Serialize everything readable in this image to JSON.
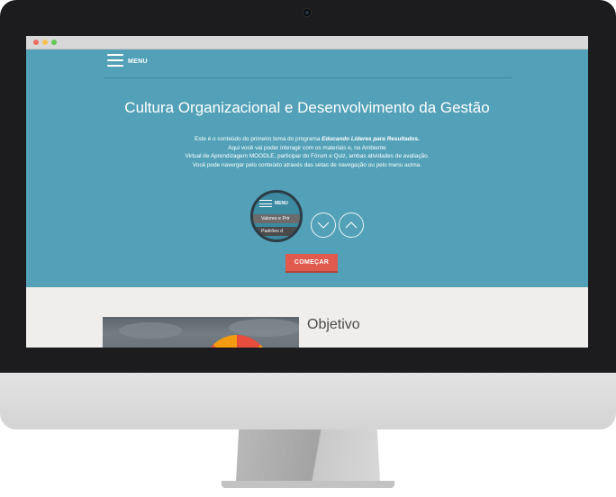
{
  "header": {
    "menu_label": "MENU"
  },
  "hero": {
    "title": "Cultura Organizacional e Desenvolvimento da Gestão",
    "desc_line1_pre": "Este é o conteúdo do primeiro tema do programa ",
    "desc_line1_em": "Educando Líderes para Resultados.",
    "desc_line2": "Aqui você vai poder interagir com os materiais e, no Ambiente",
    "desc_line3": "Virtual de Aprendizagem MOODLE, participar do Fórum e Quiz, ambas atividades de avaliação.",
    "desc_line4": "Você pode navergar pelo conteúdo através das setas de navegação ou pelo menu acima.",
    "start_label": "COMEÇAR"
  },
  "magnifier": {
    "menu_label": "MENU",
    "item1": "Valores e Prir",
    "item2": "Padrões d"
  },
  "content": {
    "section_title": "Objetivo"
  },
  "icons": {
    "menu": "hamburger-icon",
    "down": "chevron-down-icon",
    "up": "chevron-up-icon"
  },
  "colors": {
    "hero_bg": "#53a1b8",
    "accent_button": "#e05a4e",
    "content_bg": "#f0eeec"
  }
}
